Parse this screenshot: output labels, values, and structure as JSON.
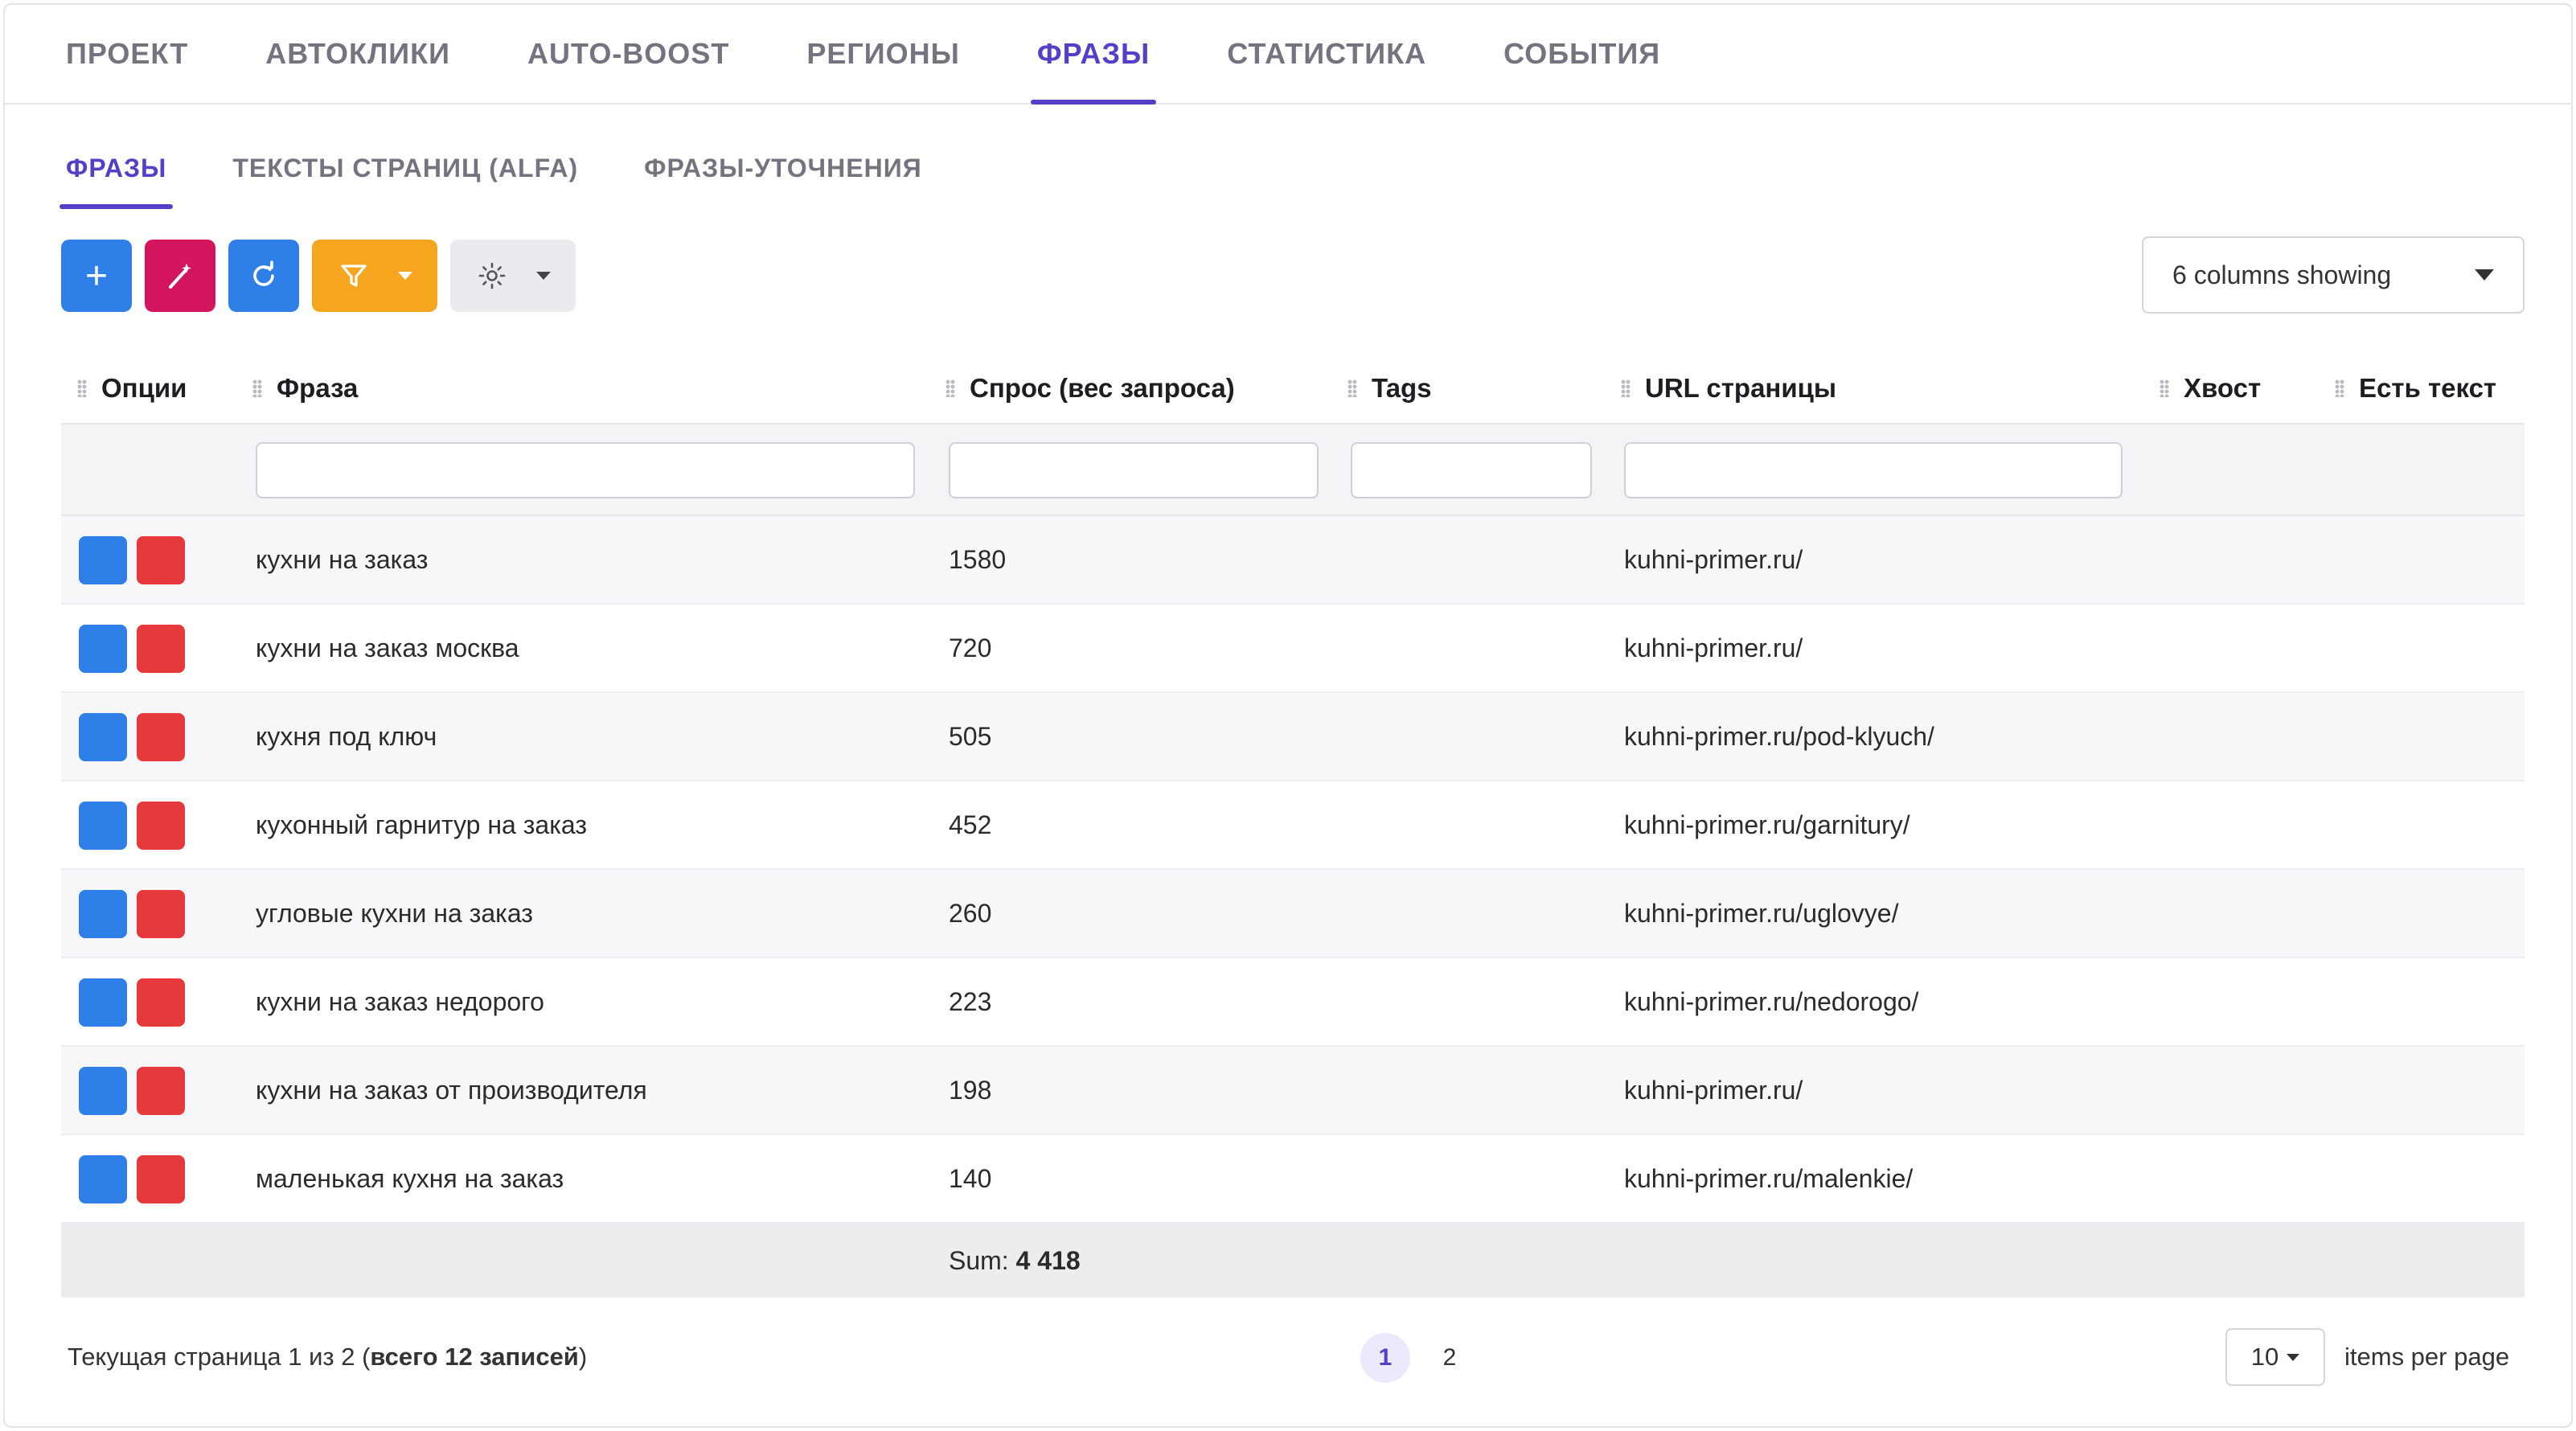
{
  "top_tabs": [
    {
      "label": "ПРОЕКТ",
      "active": false
    },
    {
      "label": "АВТОКЛИКИ",
      "active": false
    },
    {
      "label": "AUTO-BOOST",
      "active": false
    },
    {
      "label": "РЕГИОНЫ",
      "active": false
    },
    {
      "label": "ФРАЗЫ",
      "active": true
    },
    {
      "label": "СТАТИСТИКА",
      "active": false
    },
    {
      "label": "СОБЫТИЯ",
      "active": false
    }
  ],
  "sub_tabs": [
    {
      "label": "ФРАЗЫ",
      "active": true
    },
    {
      "label": "ТЕКСТЫ СТРАНИЦ (ALFA)",
      "active": false
    },
    {
      "label": "ФРАЗЫ-УТОЧНЕНИЯ",
      "active": false
    }
  ],
  "toolbar": {
    "add_label": "+",
    "icons": [
      "plus-icon",
      "magic-wand-icon",
      "refresh-icon",
      "filter-icon",
      "settings-icon"
    ],
    "colors": {
      "add": "#2f7fe9",
      "magic": "#d3155e",
      "refresh": "#2f7fe9",
      "filter": "#f6a61e",
      "settings": "#ebebef"
    }
  },
  "columns_select": {
    "value": "6 columns showing"
  },
  "table": {
    "headers": {
      "options": "Опции",
      "phrase": "Фраза",
      "demand": "Спрос (вес запроса)",
      "tags": "Tags",
      "url": "URL страницы",
      "tail": "Хвост",
      "has_text": "Есть текст"
    },
    "filters": {
      "phrase": "",
      "demand": "",
      "tags": "",
      "url": ""
    },
    "rows": [
      {
        "phrase": "кухни на заказ",
        "demand": "1580",
        "tags": "",
        "url": "kuhni-primer.ru/",
        "tail": "",
        "has_text": ""
      },
      {
        "phrase": "кухни на заказ москва",
        "demand": "720",
        "tags": "",
        "url": "kuhni-primer.ru/",
        "tail": "",
        "has_text": ""
      },
      {
        "phrase": "кухня под ключ",
        "demand": "505",
        "tags": "",
        "url": "kuhni-primer.ru/pod-klyuch/",
        "tail": "",
        "has_text": ""
      },
      {
        "phrase": "кухонный гарнитур на заказ",
        "demand": "452",
        "tags": "",
        "url": "kuhni-primer.ru/garnitury/",
        "tail": "",
        "has_text": ""
      },
      {
        "phrase": "угловые кухни на заказ",
        "demand": "260",
        "tags": "",
        "url": "kuhni-primer.ru/uglovye/",
        "tail": "",
        "has_text": ""
      },
      {
        "phrase": "кухни на заказ недорого",
        "demand": "223",
        "tags": "",
        "url": "kuhni-primer.ru/nedorogo/",
        "tail": "",
        "has_text": ""
      },
      {
        "phrase": "кухни на заказ от производителя",
        "demand": "198",
        "tags": "",
        "url": "kuhni-primer.ru/",
        "tail": "",
        "has_text": ""
      },
      {
        "phrase": "маленькая кухня на заказ",
        "demand": "140",
        "tags": "",
        "url": "kuhni-primer.ru/malenkie/",
        "tail": "",
        "has_text": ""
      }
    ],
    "sum": {
      "label": "Sum: ",
      "value": "4 418"
    }
  },
  "pagination": {
    "info_prefix": "Текущая страница 1 из 2 (",
    "info_bold": "всего 12 записей",
    "info_suffix": ")",
    "pages": [
      "1",
      "2"
    ],
    "current_page": "1",
    "per_page": "10",
    "per_page_label": "items per page"
  }
}
